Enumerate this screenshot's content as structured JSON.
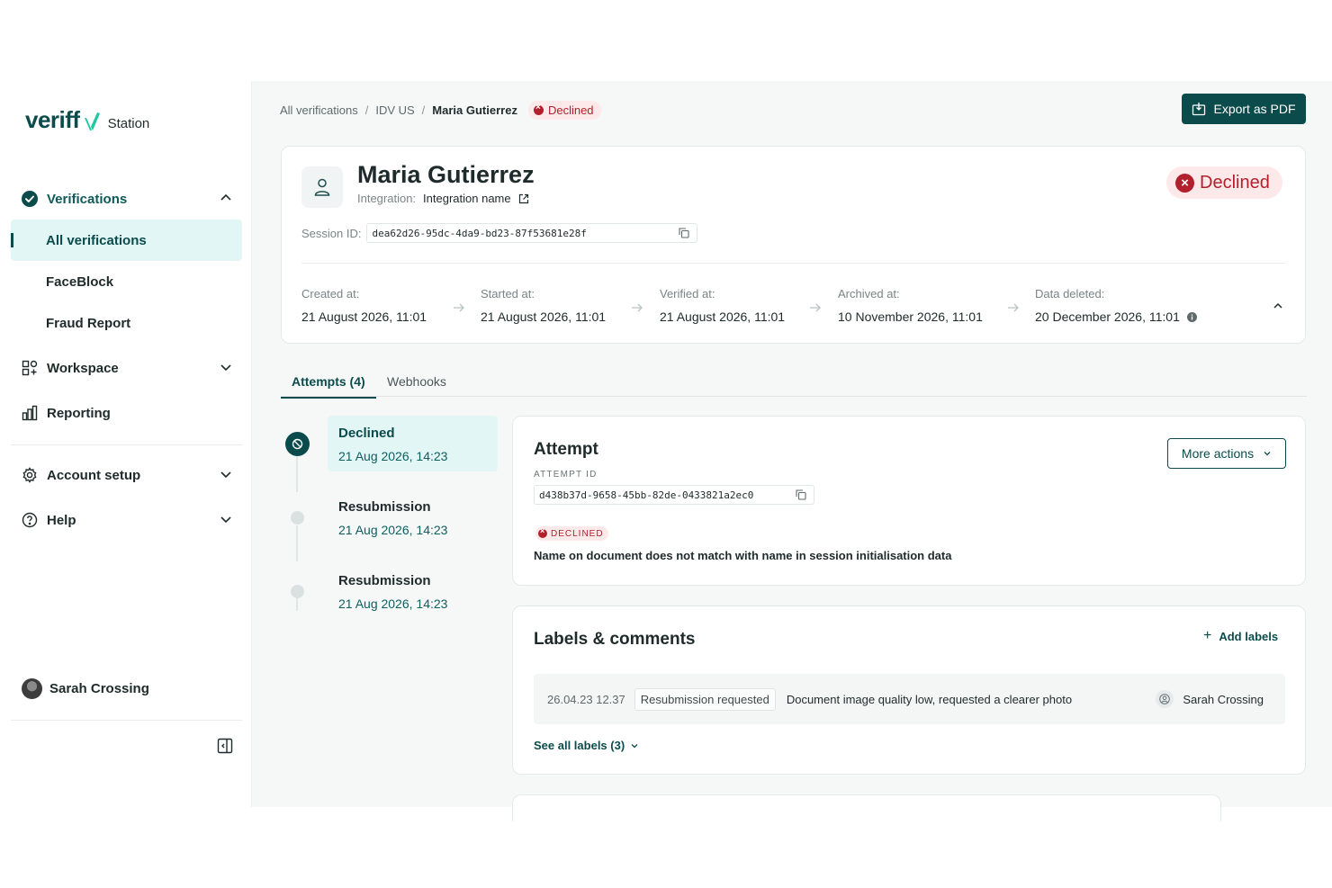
{
  "brand": {
    "logo_text": "veriff",
    "product": "Station",
    "accent": "#0b4b4b",
    "logo_mark_color": "#1fc7a2"
  },
  "sidebar": {
    "verifications": {
      "label": "Verifications",
      "icon": "check-circle-icon"
    },
    "sub_items": [
      {
        "label": "All verifications"
      },
      {
        "label": "FaceBlock"
      },
      {
        "label": "Fraud Report"
      }
    ],
    "workspace": {
      "label": "Workspace",
      "icon": "grid-icon"
    },
    "reporting": {
      "label": "Reporting",
      "icon": "bar-chart-icon"
    },
    "account_setup": {
      "label": "Account setup",
      "icon": "gear-icon"
    },
    "help": {
      "label": "Help",
      "icon": "help-circle-icon"
    },
    "user_name": "Sarah Crossing"
  },
  "breadcrumb": {
    "items": [
      "All verifications",
      "IDV US",
      "Maria Gutierrez"
    ],
    "separator": "/",
    "status": "Declined"
  },
  "export_button": "Export as PDF",
  "summary": {
    "name": "Maria Gutierrez",
    "integration_label": "Integration:",
    "integration_value": "Integration name",
    "status": "Declined",
    "session_label": "Session ID:",
    "session_id": "dea62d26-95dc-4da9-bd23-87f53681e28f",
    "dates": [
      {
        "label": "Created at:",
        "value": "21 August 2026, 11:01"
      },
      {
        "label": "Started at:",
        "value": "21 August 2026, 11:01"
      },
      {
        "label": "Verified at:",
        "value": "21 August 2026, 11:01"
      },
      {
        "label": "Archived at:",
        "value": "10 November 2026, 11:01"
      },
      {
        "label": "Data deleted:",
        "value": "20 December 2026, 11:01"
      }
    ]
  },
  "tabs": [
    {
      "label": "Attempts (4)",
      "active": true
    },
    {
      "label": "Webhooks",
      "active": false
    }
  ],
  "timeline": [
    {
      "title": "Declined",
      "date": "21 Aug 2026,  14:23"
    },
    {
      "title": "Resubmission",
      "date": "21 Aug 2026,  14:23"
    },
    {
      "title": "Resubmission",
      "date": "21 Aug 2026,  14:23"
    }
  ],
  "attempt": {
    "title": "Attempt",
    "more_actions": "More actions",
    "id_label": "ATTEMPT ID",
    "id": "d438b37d-9658-45bb-82de-0433821a2ec0",
    "status_tag": "DECLINED",
    "reason": "Name on document does not match with name in session initialisation data"
  },
  "labels_card": {
    "title": "Labels & comments",
    "add_labels": "Add labels",
    "comment": {
      "timestamp": "26.04.23 12.37",
      "label": "Resubmission requested",
      "text": "Document image quality low, requested a clearer photo",
      "author": "Sarah Crossing"
    },
    "see_all": "See all labels (3)"
  },
  "colors": {
    "declined": "#b3202d",
    "declined_bg": "#fde9ea",
    "selected_bg": "#e3f6f6"
  }
}
